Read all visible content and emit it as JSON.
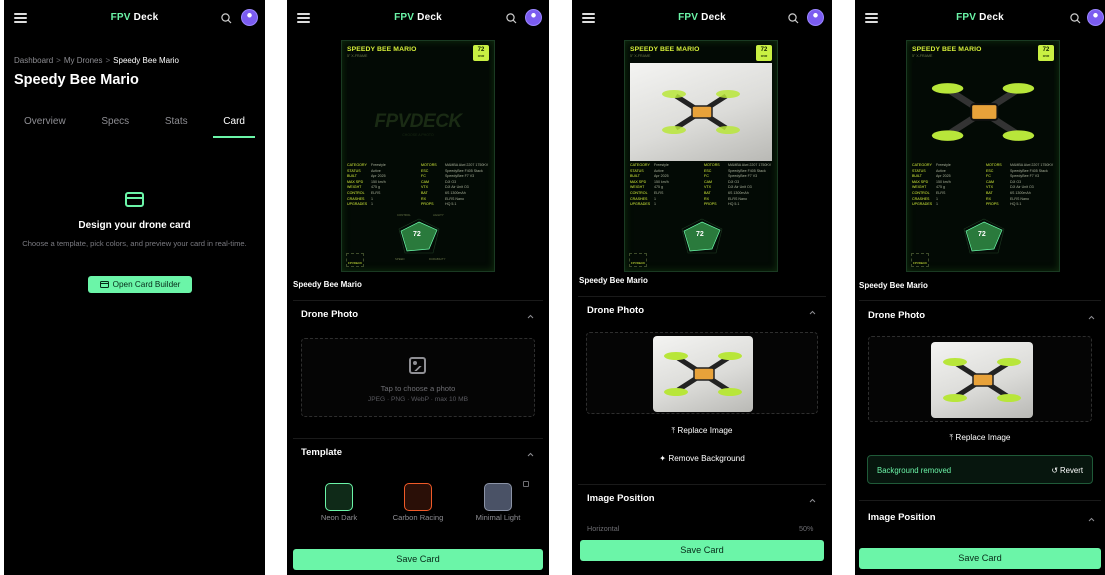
{
  "app": {
    "brand_a": "FPV",
    "brand_b": "Deck"
  },
  "screen1": {
    "breadcrumb": [
      "Dashboard",
      "My Drones",
      "Speedy Bee Mario"
    ],
    "breadcrumb_sep": ">",
    "title": "Speedy Bee Mario",
    "tabs": [
      "Overview",
      "Specs",
      "Stats",
      "Card"
    ],
    "active_tab": "Card",
    "empty_title": "Design your drone card",
    "empty_desc": "Choose a template, pick colors, and preview your card in real-time.",
    "builder_button": "Open Card Builder"
  },
  "card": {
    "title": "SPEEDY BEE MARIO",
    "subtitle": "5\" X-FRAME",
    "score": "72",
    "score_unit": "OVR",
    "watermark": "FPVDECK",
    "watermark_sub": "CHOOSE A PHOTO",
    "left_specs": [
      {
        "k": "CATEGORY",
        "v": "Freestyle"
      },
      {
        "k": "STATUS",
        "v": "Active"
      },
      {
        "k": "BUILT",
        "v": "Apr 2025"
      },
      {
        "k": "MAX SPD",
        "v": "150 km/h"
      },
      {
        "k": "WEIGHT",
        "v": "475 g"
      },
      {
        "k": "CONTROL",
        "v": "ELRS"
      },
      {
        "k": "CRASHES",
        "v": "1"
      },
      {
        "k": "UPGRADES",
        "v": "1"
      }
    ],
    "right_specs": [
      {
        "k": "MOTORS",
        "v": "MAMBA Aiwi 2207 1750KV"
      },
      {
        "k": "ESC",
        "v": "SpeedyBee F405 Stack"
      },
      {
        "k": "FC",
        "v": "SpeedyBee F7 V3"
      },
      {
        "k": "CAM",
        "v": "DJI O3"
      },
      {
        "k": "VTX",
        "v": "DJI Air Unit O3"
      },
      {
        "k": "BAT",
        "v": "6S 1300mAh"
      },
      {
        "k": "RX",
        "v": "ELRS Nano"
      },
      {
        "k": "PROPS",
        "v": "HQ 5.1"
      }
    ],
    "radar_score": "72",
    "radar_labels": [
      "CONTROL",
      "AGILITY",
      "SPEED",
      "DURABILITY",
      "RANGE"
    ],
    "logo": "FPVDECK"
  },
  "screen2": {
    "drone_name": "Speedy Bee Mario",
    "photo_section": "Drone Photo",
    "dz_title": "Tap to choose a photo",
    "dz_desc": "JPEG · PNG · WebP · max 10 MB",
    "template_section": "Template",
    "templates": [
      {
        "name": "Neon Dark",
        "color": "#1b3a25",
        "border": "#6bf5a8"
      },
      {
        "name": "Carbon Racing",
        "color": "#2a0f07",
        "border": "#f05a28"
      },
      {
        "name": "Minimal Light",
        "color": "#4a5266",
        "border": "#8b93a6"
      }
    ],
    "save": "Save Card"
  },
  "screen3": {
    "drone_name": "Speedy Bee Mario",
    "photo_section": "Drone Photo",
    "replace": "Replace Image",
    "remove_bg": "Remove Background",
    "position_section": "Image Position",
    "horizontal_label": "Horizontal",
    "horizontal_value": "50%",
    "save": "Save Card"
  },
  "screen4": {
    "drone_name": "Speedy Bee Mario",
    "photo_section": "Drone Photo",
    "replace": "Replace Image",
    "banner_msg": "Background removed",
    "revert": "Revert",
    "position_section": "Image Position",
    "save": "Save Card"
  }
}
